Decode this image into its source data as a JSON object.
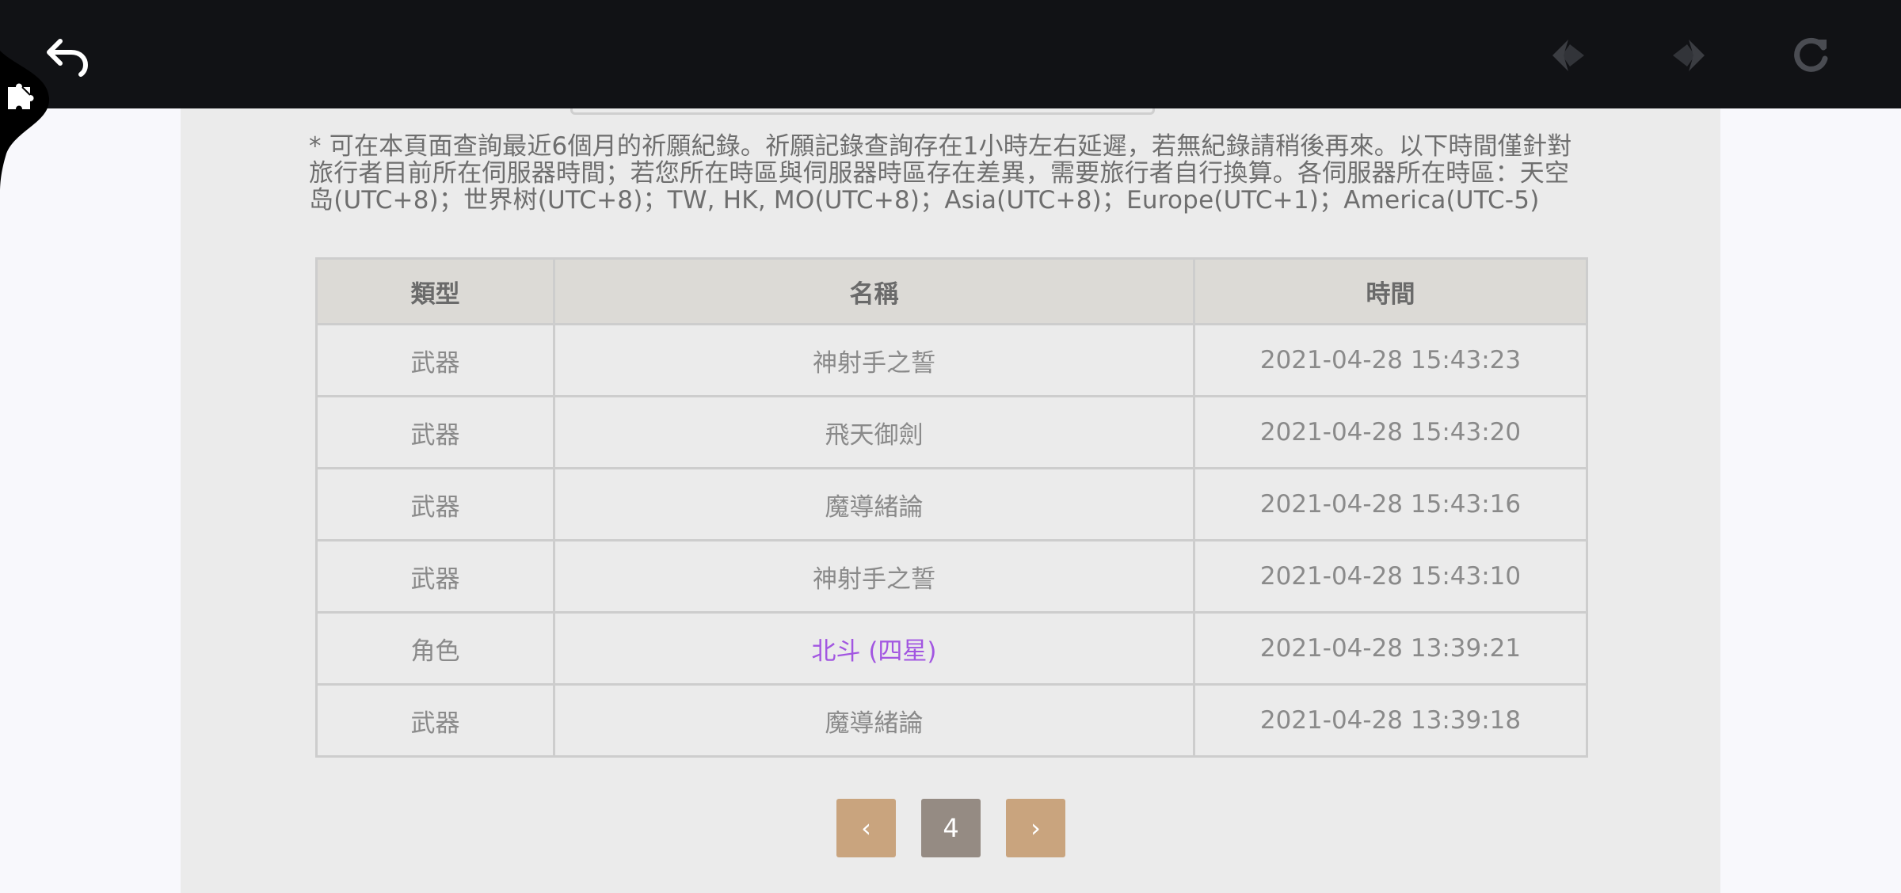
{
  "browser": {
    "icons": {
      "back": "undo-arrow-icon",
      "prev": "diamond-left-icon",
      "next": "diamond-right-icon",
      "reload": "reload-icon",
      "side": "puzzle-icon"
    },
    "bar_color": "#111215"
  },
  "notice": "* 可在本頁面查詢最近6個月的祈願紀錄。祈願記錄查詢存在1小時左右延遲，若無紀錄請稍後再來。以下時間僅針對旅行者目前所在伺服器時間；若您所在時區與伺服器時區存在差異，需要旅行者自行換算。各伺服器所在時區：天空岛(UTC+8)；世界树(UTC+8)；TW, HK, MO(UTC+8)；Asia(UTC+8)；Europe(UTC+1)；America(UTC-5)",
  "table": {
    "headers": [
      "類型",
      "名稱",
      "時間"
    ],
    "rows": [
      {
        "type": "武器",
        "name": "神射手之誓",
        "time": "2021-04-28 15:43:23"
      },
      {
        "type": "武器",
        "name": "飛天御劍",
        "time": "2021-04-28 15:43:20"
      },
      {
        "type": "武器",
        "name": "魔導緒論",
        "time": "2021-04-28 15:43:16"
      },
      {
        "type": "武器",
        "name": "神射手之誓",
        "time": "2021-04-28 15:43:10"
      },
      {
        "type": "角色",
        "name": "北斗 (四星)",
        "time": "2021-04-28 13:39:21",
        "highlight_color": "#a256e1"
      },
      {
        "type": "武器",
        "name": "魔導緒論",
        "time": "2021-04-28 13:39:18"
      }
    ]
  },
  "pagination": {
    "prev_symbol": "‹",
    "page": "4",
    "next_symbol": "›",
    "arrow_color": "#c9a47e",
    "page_color": "#958b83"
  }
}
